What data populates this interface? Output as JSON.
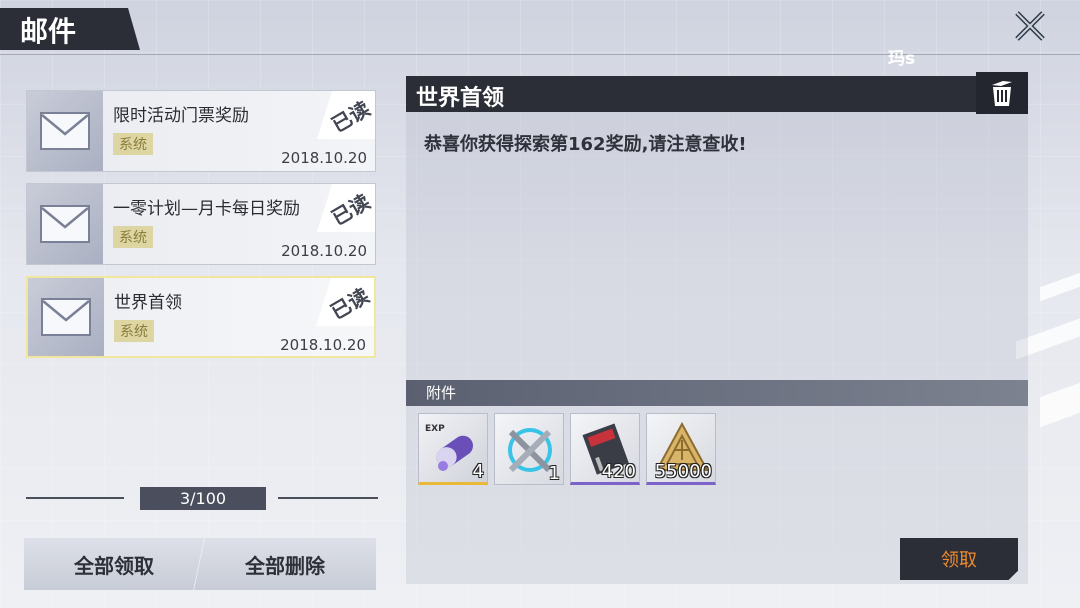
{
  "header": {
    "title": "邮件",
    "user_name": "玛s"
  },
  "mail_list": [
    {
      "title": "限时活动门票奖励",
      "tag": "系统",
      "date": "2018.10.20",
      "status": "已读"
    },
    {
      "title": "一零计划—月卡每日奖励",
      "tag": "系统",
      "date": "2018.10.20",
      "status": "已读"
    },
    {
      "title": "世界首领",
      "tag": "系统",
      "date": "2018.10.20",
      "status": "已读"
    }
  ],
  "counter": "3/100",
  "buttons": {
    "claim_all": "全部领取",
    "delete_all": "全部删除",
    "claim": "领取"
  },
  "detail": {
    "title": "世界首领",
    "body": "恭喜你获得探索第162奖励,请注意查收!",
    "attachments_label": "附件",
    "attachments": [
      {
        "icon": "exp-capsule-icon",
        "label": "EXP",
        "quantity": "4"
      },
      {
        "icon": "crossed-swords-icon",
        "quantity": "1"
      },
      {
        "icon": "book-icon",
        "quantity": "420"
      },
      {
        "icon": "gold-emblem-icon",
        "quantity": "55000"
      }
    ]
  },
  "colors": {
    "dark_panel": "#2b2e37",
    "accent_orange": "#f08a2c",
    "selected_border": "#f0e79c",
    "tag_bg": "#ddd6a2"
  }
}
